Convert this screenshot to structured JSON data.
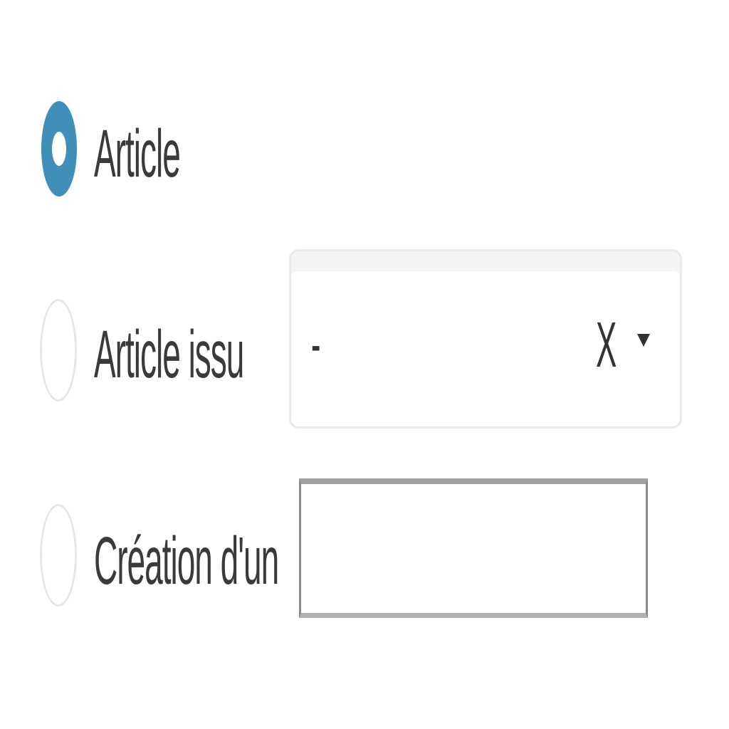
{
  "options": [
    {
      "label": "Article",
      "checked": true
    },
    {
      "label": "Article issu",
      "checked": false
    },
    {
      "label": "Création d'un",
      "checked": false
    }
  ],
  "select": {
    "value": "-",
    "clear_label": "X",
    "caret_icon": "caret-down-icon"
  },
  "text_input": {
    "value": "",
    "placeholder": ""
  },
  "colors": {
    "radio_checked": "#3f8fb8",
    "radio_unchecked_border": "#e6e6e6"
  }
}
